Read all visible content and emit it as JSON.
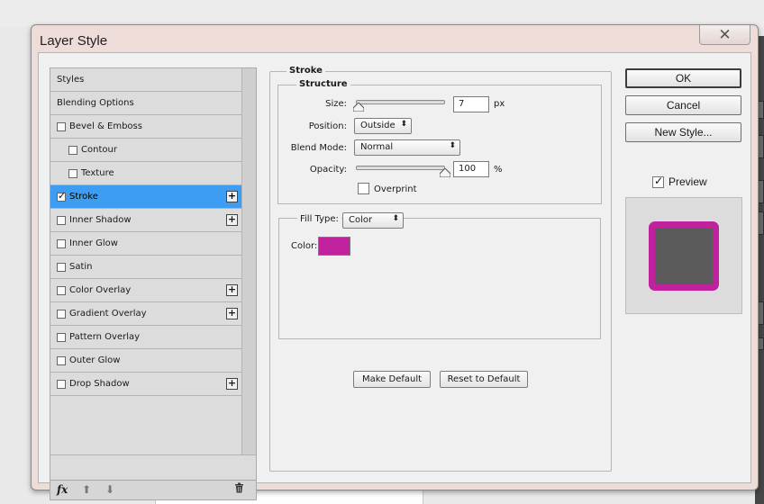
{
  "dialog": {
    "title": "Layer Style",
    "close_glyph": "✕"
  },
  "styles_list": [
    {
      "label": "Styles",
      "checkbox": false,
      "indent": false,
      "selected": false,
      "plus": false
    },
    {
      "label": "Blending Options",
      "checkbox": false,
      "indent": false,
      "selected": false,
      "plus": false
    },
    {
      "label": "Bevel & Emboss",
      "checkbox": true,
      "checked": false,
      "indent": false,
      "selected": false,
      "plus": false
    },
    {
      "label": "Contour",
      "checkbox": true,
      "checked": false,
      "indent": true,
      "selected": false,
      "plus": false
    },
    {
      "label": "Texture",
      "checkbox": true,
      "checked": false,
      "indent": true,
      "selected": false,
      "plus": false
    },
    {
      "label": "Stroke",
      "checkbox": true,
      "checked": true,
      "indent": false,
      "selected": true,
      "plus": true
    },
    {
      "label": "Inner Shadow",
      "checkbox": true,
      "checked": false,
      "indent": false,
      "selected": false,
      "plus": true
    },
    {
      "label": "Inner Glow",
      "checkbox": true,
      "checked": false,
      "indent": false,
      "selected": false,
      "plus": false
    },
    {
      "label": "Satin",
      "checkbox": true,
      "checked": false,
      "indent": false,
      "selected": false,
      "plus": false
    },
    {
      "label": "Color Overlay",
      "checkbox": true,
      "checked": false,
      "indent": false,
      "selected": false,
      "plus": true
    },
    {
      "label": "Gradient Overlay",
      "checkbox": true,
      "checked": false,
      "indent": false,
      "selected": false,
      "plus": true
    },
    {
      "label": "Pattern Overlay",
      "checkbox": true,
      "checked": false,
      "indent": false,
      "selected": false,
      "plus": false
    },
    {
      "label": "Outer Glow",
      "checkbox": true,
      "checked": false,
      "indent": false,
      "selected": false,
      "plus": false
    },
    {
      "label": "Drop Shadow",
      "checkbox": true,
      "checked": false,
      "indent": false,
      "selected": false,
      "plus": true
    }
  ],
  "footer": {
    "fx_label": "fx",
    "up_glyph": "⬆",
    "down_glyph": "⬇",
    "trash_glyph": "🗑"
  },
  "stroke": {
    "heading": "Stroke",
    "structure_heading": "Structure",
    "size_label": "Size:",
    "size_value": "7",
    "size_unit": "px",
    "size_level": 0.03,
    "position_label": "Position:",
    "position_value": "Outside",
    "blend_label": "Blend Mode:",
    "blend_value": "Normal",
    "opacity_label": "Opacity:",
    "opacity_value": "100",
    "opacity_unit": "%",
    "opacity_level": 1.0,
    "overprint_label": "Overprint",
    "fill_type_label": "Fill Type:",
    "fill_type_value": "Color",
    "color_label": "Color:",
    "color_hex": "#c0229e",
    "make_default": "Make Default",
    "reset_default": "Reset to Default"
  },
  "right": {
    "ok": "OK",
    "cancel": "Cancel",
    "new_style": "New Style...",
    "preview_label": "Preview",
    "preview_checked": true,
    "preview_fill": "#5b5b5b",
    "preview_stroke": "#c0229e"
  },
  "colors": {
    "selection": "#3d9df3",
    "titlebar": "#eedcd8"
  }
}
